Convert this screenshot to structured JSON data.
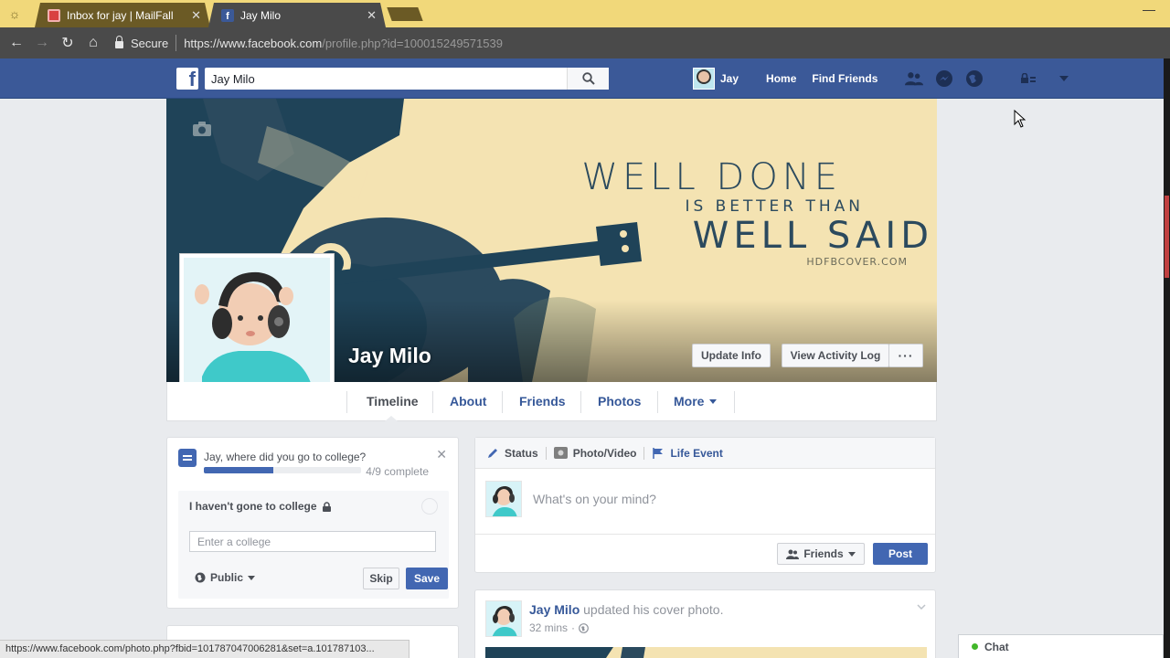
{
  "browser": {
    "tabs": [
      {
        "title": "Inbox for jay | MailFall",
        "active": false
      },
      {
        "title": "Jay Milo",
        "active": true
      }
    ],
    "secure_label": "Secure",
    "url_main": "https://www.facebook.com",
    "url_rest": "/profile.php?id=100015249571539",
    "status_url": "https://www.facebook.com/photo.php?fbid=101787047006281&set=a.101787103..."
  },
  "fb": {
    "logo": "f",
    "search_value": "Jay Milo",
    "nav_user": "Jay",
    "nav_home": "Home",
    "nav_find_friends": "Find Friends"
  },
  "cover": {
    "line1": "WELL DONE",
    "line2": "IS BETTER THAN",
    "line3": "WELL SAID",
    "watermark": "HDFBCOVER.COM"
  },
  "profile": {
    "name": "Jay Milo",
    "update_info": "Update Info",
    "view_activity_log": "View Activity Log",
    "more_dots": "···",
    "tabs": [
      "Timeline",
      "About",
      "Friends",
      "Photos",
      "More"
    ]
  },
  "question": {
    "title": "Jay, where did you go to college?",
    "progress_text": "4/9 complete",
    "progress_fraction": 0.44,
    "option": "I haven't gone to college",
    "input_placeholder": "Enter a college",
    "audience": "Public",
    "skip": "Skip",
    "save": "Save"
  },
  "composer": {
    "tab_status": "Status",
    "tab_photo": "Photo/Video",
    "tab_life": "Life Event",
    "placeholder": "What's on your mind?",
    "audience": "Friends",
    "post": "Post"
  },
  "story": {
    "name": "Jay Milo",
    "action": " updated his cover photo.",
    "time": "32 mins",
    "separator": "·"
  },
  "chat": {
    "label": "Chat"
  },
  "colors": {
    "fb_blue": "#3b5998",
    "button_blue": "#4267b2",
    "link_blue": "#365899",
    "tabbar": "#f1d87a",
    "chat_online": "#42b72a"
  }
}
